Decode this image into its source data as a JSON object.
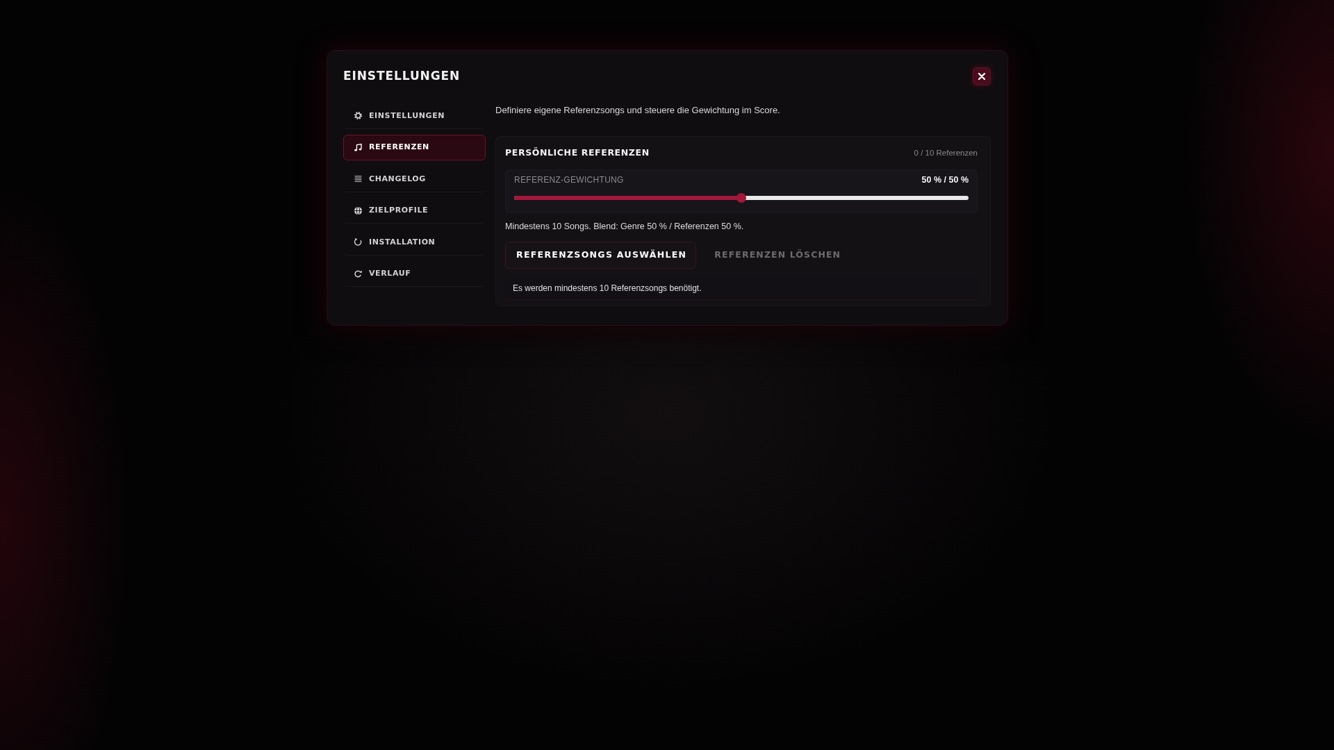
{
  "modal": {
    "title": "EINSTELLUNGEN"
  },
  "sidebar": {
    "items": [
      {
        "label": "EINSTELLUNGEN",
        "kind": "gear",
        "selected": false
      },
      {
        "label": "REFERENZEN",
        "kind": "note",
        "selected": true
      },
      {
        "label": "CHANGELOG",
        "kind": "list",
        "selected": false
      },
      {
        "label": "ZIELPROFILE",
        "kind": "globe",
        "selected": false
      },
      {
        "label": "INSTALLATION",
        "kind": "refresh",
        "selected": false
      },
      {
        "label": "VERLAUF",
        "kind": "history",
        "selected": false
      }
    ]
  },
  "content": {
    "description": "Definiere eigene Referenzsongs und steuere die Gewichtung im Score.",
    "card": {
      "title": "PERSÖNLICHE REFERENZEN",
      "count": "0 / 10 Referenzen",
      "weighting": {
        "label": "REFERENZ-GEWICHTUNG",
        "reading": "50 % / 50 %",
        "level": 0.5
      },
      "hint": "Mindestens 10 Songs. Blend: Genre 50 % / Referenzen 50 %.",
      "buttons": [
        {
          "label": "REFERENZSONGS AUSWÄHLEN",
          "disabled": false
        },
        {
          "label": "REFERENZEN LÖSCHEN",
          "disabled": true
        }
      ],
      "notice": "Es werden mindestens 10 Referenzsongs benötigt."
    }
  }
}
